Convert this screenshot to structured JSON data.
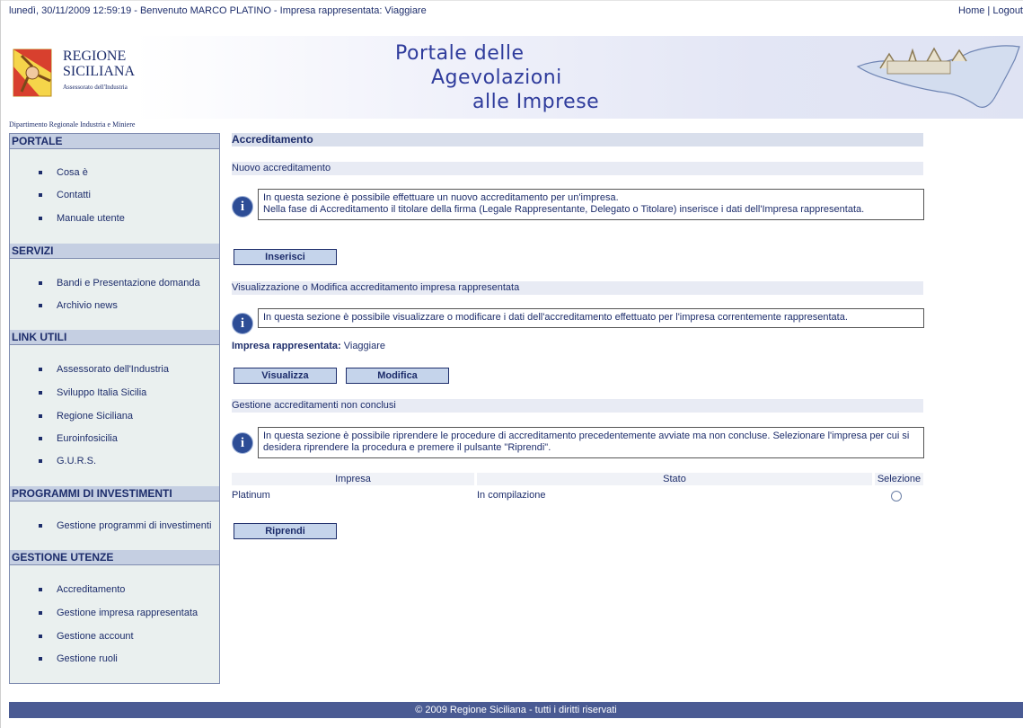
{
  "topbar": {
    "welcome": "lunedì, 30/11/2009 12:59:19  - Benvenuto MARCO PLATINO - Impresa rappresentata: Viaggiare",
    "home": "Home",
    "separator": "|",
    "logout": "Logout"
  },
  "header": {
    "region_line1": "REGIONE",
    "region_line2": "SICILIANA",
    "assessorato": "Assessorato dell'Industria",
    "dipartimento": "Dipartimento Regionale Industria e Miniere",
    "portal_title": [
      "Portale delle",
      "Agevolazioni",
      "alle Imprese"
    ]
  },
  "sidebar": {
    "sections": [
      {
        "title": "PORTALE",
        "items": [
          "Cosa è",
          "Contatti",
          "Manuale utente"
        ]
      },
      {
        "title": "SERVIZI",
        "items": [
          "Bandi e Presentazione domanda",
          "Archivio news"
        ]
      },
      {
        "title": "LINK UTILI",
        "items": [
          "Assessorato dell'Industria",
          "Sviluppo Italia Sicilia",
          "Regione Siciliana",
          "Euroinfosicilia",
          "G.U.R.S."
        ]
      },
      {
        "title": "PROGRAMMI DI INVESTIMENTI",
        "items": [
          "Gestione programmi di investimenti"
        ]
      },
      {
        "title": "GESTIONE UTENZE",
        "items": [
          "Accreditamento",
          "Gestione impresa rappresentata",
          "Gestione account",
          "Gestione ruoli"
        ]
      }
    ]
  },
  "main": {
    "title": "Accreditamento",
    "nuovo": {
      "title": "Nuovo accreditamento",
      "info_line1": "In questa sezione è possibile effettuare un nuovo accreditamento per un'impresa.",
      "info_line2": "Nella fase di Accreditamento il titolare della firma (Legale Rappresentante, Delegato o Titolare) inserisce i dati dell'Impresa rappresentata.",
      "button": "Inserisci"
    },
    "visualizza": {
      "title": "Visualizzazione o Modifica accreditamento impresa rappresentata",
      "info": "In questa sezione è possibile visualizzare o modificare i dati dell'accreditamento effettuato per l'impresa correntemente rappresentata.",
      "impresa_label": "Impresa rappresentata:",
      "impresa_value": "Viaggiare",
      "btn_visualizza": "Visualizza",
      "btn_modifica": "Modifica"
    },
    "gestione": {
      "title": "Gestione accreditamenti non conclusi",
      "info": "In questa sezione è possibile riprendere le procedure di accreditamento precedentemente avviate ma non concluse. Selezionare l'impresa per cui si desidera riprendere la procedura e premere il pulsante \"Riprendi\".",
      "columns": [
        "Impresa",
        "Stato",
        "Selezione"
      ],
      "rows": [
        {
          "impresa": "Platinum",
          "stato": "In compilazione"
        }
      ],
      "button": "Riprendi"
    }
  },
  "footer": {
    "text": "© 2009 Regione Siciliana - tutti i diritti riservati"
  },
  "colors": {
    "navy": "#1d2d6b",
    "sidebar_bg": "#eaf0ef",
    "header_blue": "#c5cfe2",
    "footer_bg": "#4a5b93"
  },
  "icons": [
    "info-icon",
    "radio-button"
  ]
}
